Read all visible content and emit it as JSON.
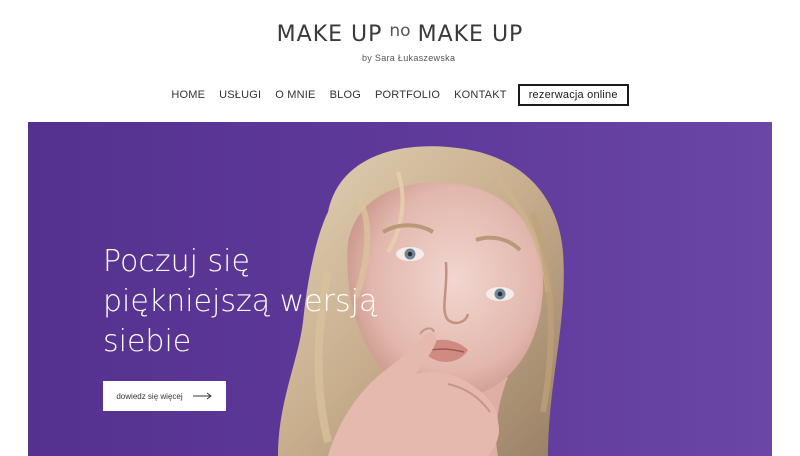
{
  "logo": {
    "title_left": "MAKE UP",
    "title_mid": "no",
    "title_right": "MAKE UP",
    "subtitle": "by Sara Łukaszewska"
  },
  "nav": {
    "items": [
      {
        "label": "HOME"
      },
      {
        "label": "USŁUGI"
      },
      {
        "label": "O MNIE"
      },
      {
        "label": "BLOG"
      },
      {
        "label": "PORTFOLIO"
      },
      {
        "label": "KONTAKT"
      }
    ],
    "cta": "rezerwacja online"
  },
  "hero": {
    "title_lines": [
      "Poczuj się",
      "piękniejszą wersją",
      "siebie"
    ],
    "button_label": "dowiedz się więcej",
    "button_icon": "arrow-right-icon",
    "background_color": "#5f3a9b"
  }
}
